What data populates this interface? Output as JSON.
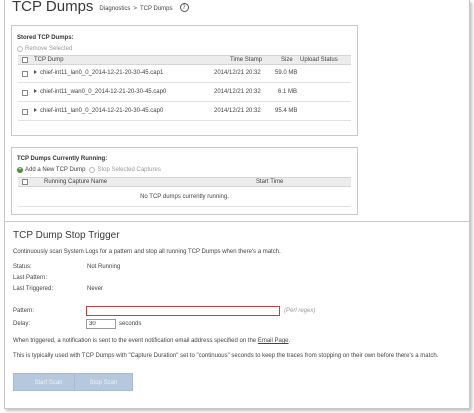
{
  "header": {
    "title": "TCP Dumps",
    "breadcrumb": [
      "Diagnostics",
      "TCP Dumps"
    ],
    "breadcrumb_sep": ">"
  },
  "stored": {
    "title": "Stored TCP Dumps:",
    "remove_label": "Remove Selected",
    "columns": [
      "TCP Dump",
      "Time Stamp",
      "Size",
      "Upload Status"
    ],
    "rows": [
      {
        "name": "chief-int11_lan0_0_2014-12-21-20-30-45.cap1",
        "timestamp": "2014/12/21 20:32",
        "size": "59.0 MB",
        "status": ""
      },
      {
        "name": "chief-int11_wan0_0_2014-12-21-20-30-45.cap0",
        "timestamp": "2014/12/21 20:32",
        "size": "6.1 MB",
        "status": ""
      },
      {
        "name": "chief-int11_lan0_0_2014-12-21-20-30-45.cap0",
        "timestamp": "2014/12/21 20:32",
        "size": "95.4 MB",
        "status": ""
      }
    ]
  },
  "running": {
    "title": "TCP Dumps Currently Running:",
    "add_label": "Add a New TCP Dump",
    "stop_label": "Stop Selected Captures",
    "columns": [
      "Running Capture Name",
      "Start Time"
    ],
    "empty_message": "No TCP dumps currently running."
  },
  "trigger": {
    "title": "TCP Dump Stop Trigger",
    "description": "Continuously scan System Logs for a pattern and stop all running TCP Dumps when there's a match.",
    "status_label": "Status:",
    "status_value": "Not Running",
    "last_pattern_label": "Last Pattern:",
    "last_pattern_value": "",
    "last_triggered_label": "Last Triggered:",
    "last_triggered_value": "Never",
    "pattern_label": "Pattern:",
    "pattern_value": "",
    "pattern_hint": "(Perl regex)",
    "delay_label": "Delay:",
    "delay_value": "30",
    "delay_unit": "seconds",
    "note1_prefix": "When triggered, a notification is sent to the event notification email address specified on the ",
    "note1_link": "Email Page",
    "note1_suffix": ".",
    "note2": "This is typically used with TCP Dumps with \"Capture Duration\" set to \"continuous\" seconds to keep the traces from stopping on their own before there's a match.",
    "start_button": "Start Scan",
    "stop_button": "Stop Scan"
  },
  "colors": {
    "button_bg": "#b6c8de",
    "pattern_border": "#c04040",
    "add_icon": "#4a8a3a"
  }
}
